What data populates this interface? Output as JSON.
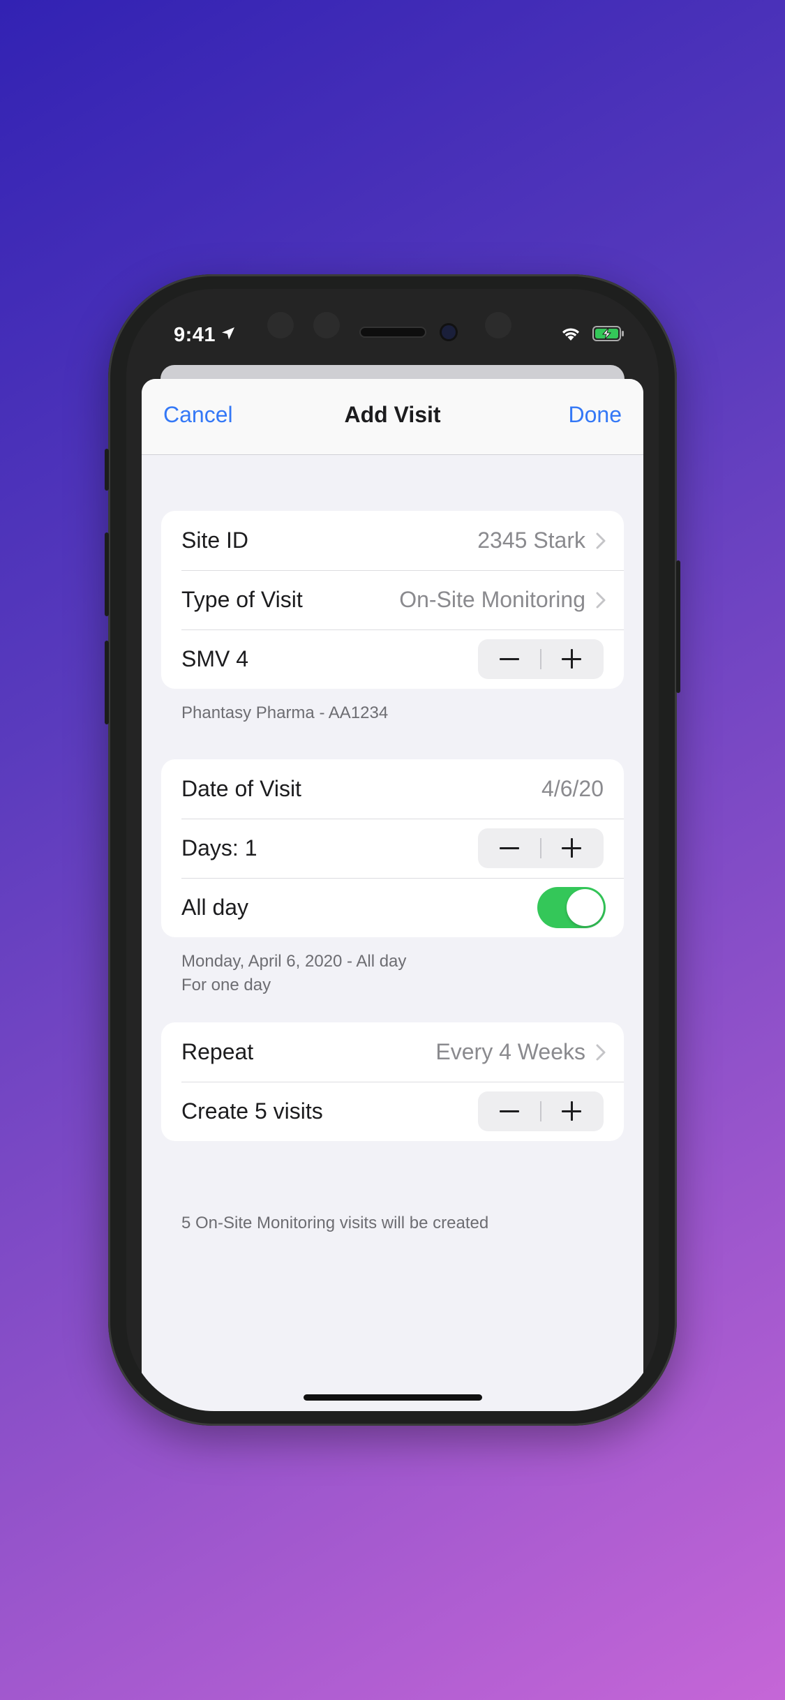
{
  "status_bar": {
    "time": "9:41"
  },
  "nav": {
    "cancel_label": "Cancel",
    "title": "Add Visit",
    "done_label": "Done"
  },
  "section1": {
    "site_id_label": "Site ID",
    "site_id_value": "2345 Stark",
    "visit_type_label": "Type of Visit",
    "visit_type_value": "On-Site Monitoring",
    "smv_label": "SMV 4",
    "footer": "Phantasy Pharma - AA1234"
  },
  "section2": {
    "date_label": "Date of Visit",
    "date_value": "4/6/20",
    "days_label": "Days: 1",
    "all_day_label": "All day",
    "all_day_on": true,
    "footer_line1": "Monday, April 6, 2020 - All day",
    "footer_line2": "For one day"
  },
  "section3": {
    "repeat_label": "Repeat",
    "repeat_value": "Every 4 Weeks",
    "create_label": "Create 5 visits",
    "footer": "5 On-Site Monitoring visits will be created"
  },
  "colors": {
    "accent": "#3478f6",
    "toggle_on": "#34c759",
    "background": "#f2f2f7"
  }
}
